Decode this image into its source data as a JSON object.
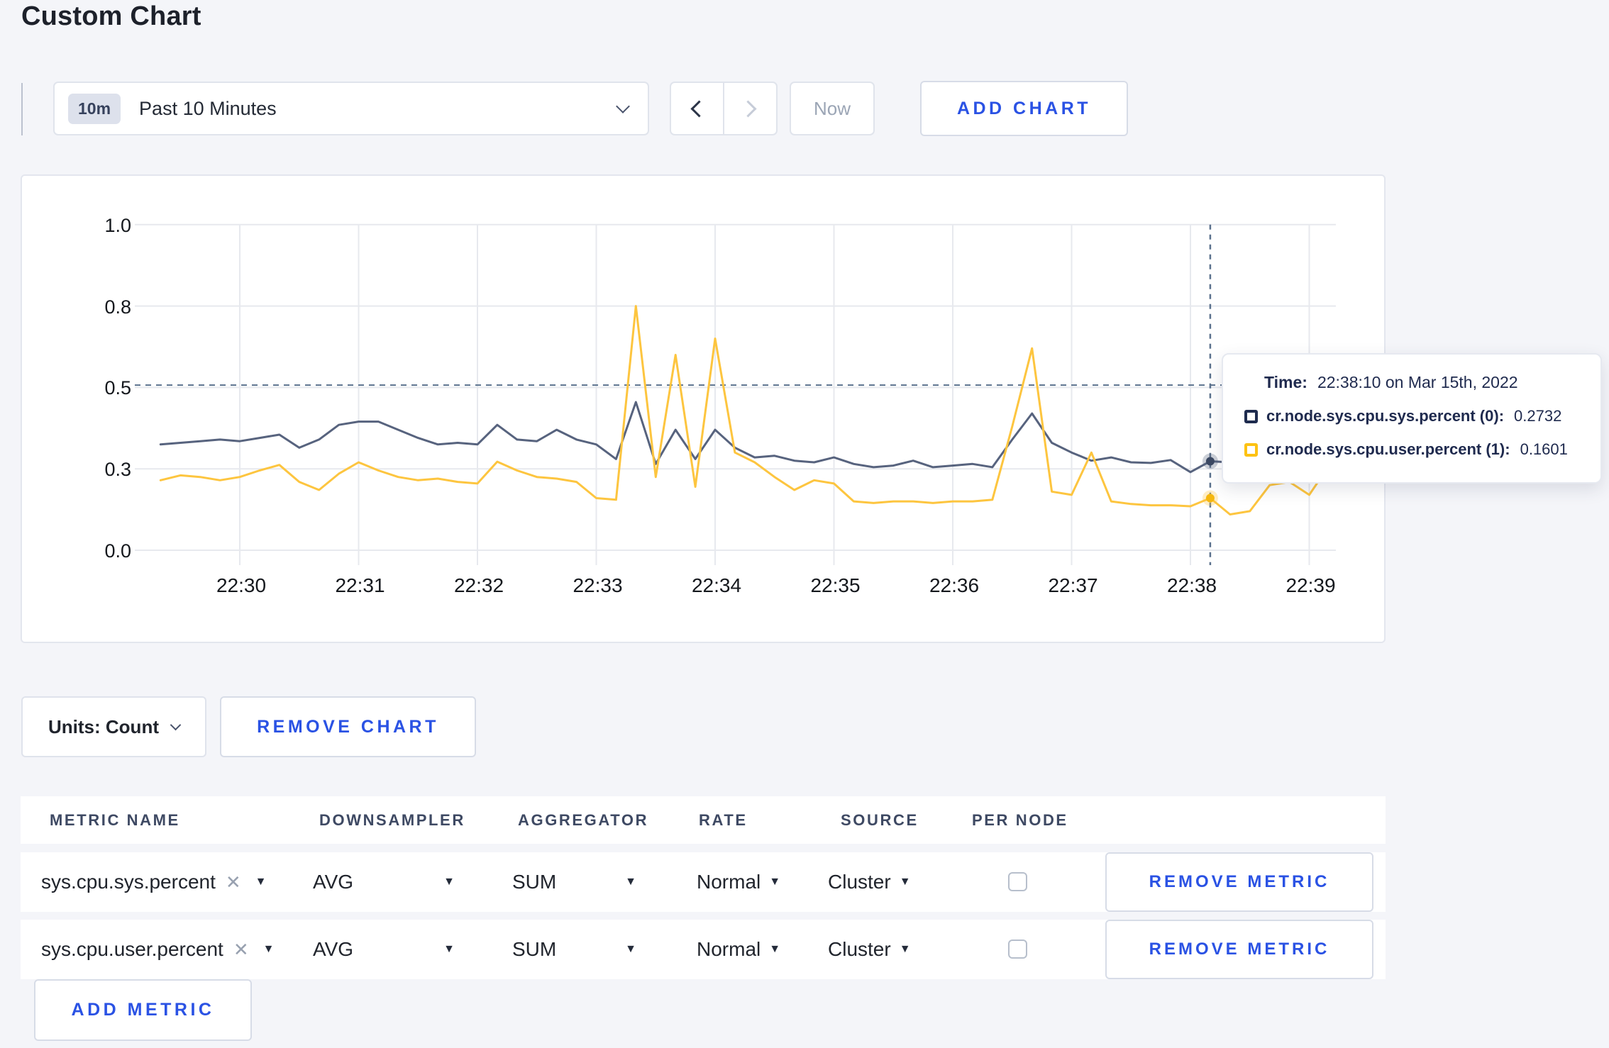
{
  "page": {
    "title": "Custom Chart"
  },
  "toolbar": {
    "time_range": {
      "badge": "10m",
      "label": "Past 10 Minutes"
    },
    "now_label": "Now",
    "add_chart_label": "ADD CHART"
  },
  "chart_data": {
    "type": "line",
    "title": "",
    "xlabel": "",
    "ylabel": "",
    "ylim": [
      0,
      1
    ],
    "grid": true,
    "legend": "none",
    "x_ticks": [
      "22:30",
      "22:31",
      "22:32",
      "22:33",
      "22:34",
      "22:35",
      "22:36",
      "22:37",
      "22:38",
      "22:39"
    ],
    "y_ticks": [
      {
        "label": "1.0",
        "value": 1.0
      },
      {
        "label": "0.8",
        "value": 0.75
      },
      {
        "label": "0.5",
        "value": 0.5
      },
      {
        "label": "0.3",
        "value": 0.25
      },
      {
        "label": "0.0",
        "value": 0.0
      }
    ],
    "x_start_time": "22:29:20",
    "x_interval_seconds": 10,
    "series": [
      {
        "name": "cr.node.sys.cpu.sys.percent",
        "color": "#57637e",
        "values": [
          0.325,
          0.33,
          0.335,
          0.34,
          0.335,
          0.345,
          0.355,
          0.315,
          0.34,
          0.385,
          0.395,
          0.395,
          0.37,
          0.345,
          0.325,
          0.33,
          0.325,
          0.385,
          0.34,
          0.335,
          0.37,
          0.34,
          0.325,
          0.28,
          0.455,
          0.265,
          0.37,
          0.28,
          0.37,
          0.315,
          0.285,
          0.29,
          0.275,
          0.27,
          0.285,
          0.265,
          0.255,
          0.26,
          0.275,
          0.255,
          0.26,
          0.265,
          0.255,
          0.34,
          0.42,
          0.33,
          0.3,
          0.275,
          0.285,
          0.27,
          0.268,
          0.277,
          0.24,
          0.2732,
          0.27,
          0.275,
          0.27,
          0.285,
          0.28,
          0.3
        ]
      },
      {
        "name": "cr.node.sys.cpu.user.percent",
        "color": "#fdc53f",
        "values": [
          0.215,
          0.23,
          0.225,
          0.215,
          0.225,
          0.245,
          0.262,
          0.21,
          0.185,
          0.235,
          0.27,
          0.245,
          0.225,
          0.215,
          0.22,
          0.21,
          0.205,
          0.272,
          0.245,
          0.225,
          0.22,
          0.21,
          0.16,
          0.155,
          0.75,
          0.225,
          0.6,
          0.195,
          0.65,
          0.3,
          0.27,
          0.225,
          0.185,
          0.215,
          0.205,
          0.15,
          0.145,
          0.15,
          0.15,
          0.145,
          0.15,
          0.15,
          0.155,
          0.38,
          0.62,
          0.18,
          0.17,
          0.3,
          0.15,
          0.142,
          0.138,
          0.138,
          0.135,
          0.1601,
          0.11,
          0.12,
          0.2,
          0.21,
          0.17,
          0.26
        ]
      }
    ],
    "crosshair": {
      "point_index": 53,
      "hline_value": 0.507
    },
    "tooltip": {
      "time_label": "Time:",
      "time_value": "22:38:10 on Mar 15th, 2022",
      "rows": [
        {
          "label": "cr.node.sys.cpu.sys.percent (0):",
          "value": "0.2732",
          "swatch_color": "#1e2b4e"
        },
        {
          "label": "cr.node.sys.cpu.user.percent (1):",
          "value": "0.1601",
          "swatch_color": "#fdc213"
        }
      ]
    }
  },
  "chart_controls": {
    "units_label": "Units: Count",
    "remove_chart_label": "REMOVE CHART"
  },
  "metrics_table": {
    "headers": [
      "METRIC NAME",
      "DOWNSAMPLER",
      "AGGREGATOR",
      "RATE",
      "SOURCE",
      "PER NODE"
    ],
    "rows": [
      {
        "metric": "sys.cpu.sys.percent",
        "remove_x": "✕",
        "downsampler": "AVG",
        "aggregator": "SUM",
        "rate": "Normal",
        "source": "Cluster",
        "per_node_checked": false,
        "remove_label": "REMOVE METRIC"
      },
      {
        "metric": "sys.cpu.user.percent",
        "remove_x": "✕",
        "downsampler": "AVG",
        "aggregator": "SUM",
        "rate": "Normal",
        "source": "Cluster",
        "per_node_checked": false,
        "remove_label": "REMOVE METRIC"
      }
    ],
    "add_metric_label": "ADD METRIC"
  },
  "colors": {
    "accent_blue": "#2a52e4",
    "page_background": "#f4f5f9",
    "series_sys": "#57637e",
    "series_user": "#fdc53f",
    "gridline": "#e7e9ee",
    "crosshair": "#5a718d"
  }
}
